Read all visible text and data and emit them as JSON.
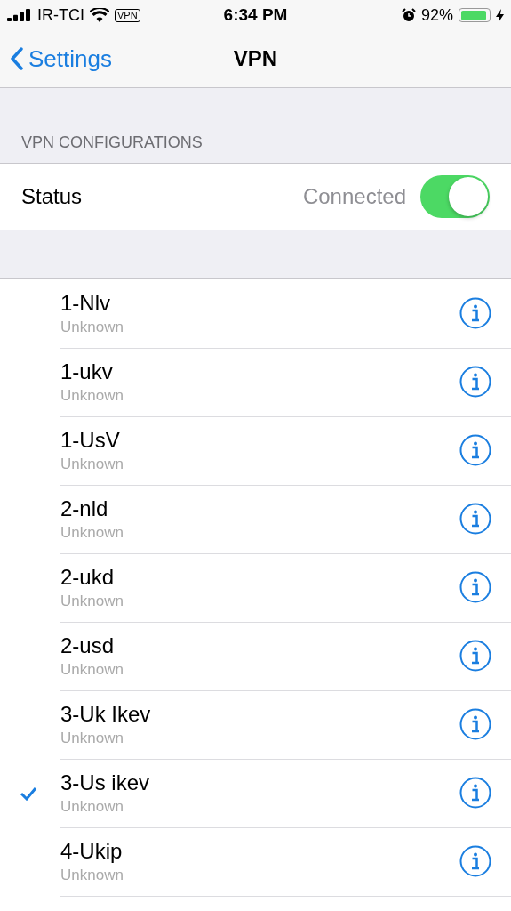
{
  "status_bar": {
    "carrier": "IR-TCI",
    "vpn_badge": "VPN",
    "time": "6:34 PM",
    "battery": "92%"
  },
  "nav": {
    "back": "Settings",
    "title": "VPN"
  },
  "section_header": "VPN CONFIGURATIONS",
  "status_row": {
    "label": "Status",
    "value": "Connected",
    "on": true
  },
  "configurations": [
    {
      "name": "1-Nlv",
      "status": "Unknown",
      "selected": false
    },
    {
      "name": "1-ukv",
      "status": "Unknown",
      "selected": false
    },
    {
      "name": "1-UsV",
      "status": "Unknown",
      "selected": false
    },
    {
      "name": "2-nld",
      "status": "Unknown",
      "selected": false
    },
    {
      "name": "2-ukd",
      "status": "Unknown",
      "selected": false
    },
    {
      "name": "2-usd",
      "status": "Unknown",
      "selected": false
    },
    {
      "name": "3-Uk Ikev",
      "status": "Unknown",
      "selected": false
    },
    {
      "name": "3-Us ikev",
      "status": "Unknown",
      "selected": true
    },
    {
      "name": "4-Ukip",
      "status": "Unknown",
      "selected": false
    }
  ]
}
